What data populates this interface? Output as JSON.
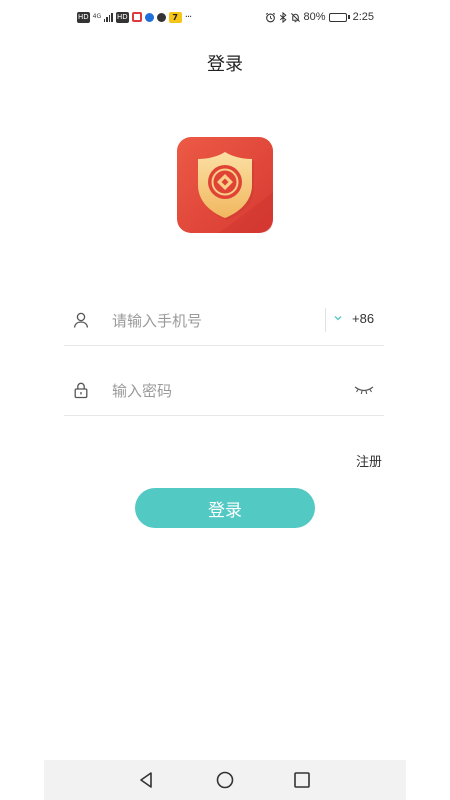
{
  "status_bar": {
    "left_chips": [
      "HD",
      "HD"
    ],
    "network": "4G",
    "more": "···",
    "yellow_badge": "7",
    "battery": "80%",
    "battery_level": 0.8,
    "time": "2:25"
  },
  "header": {
    "title": "登录"
  },
  "form": {
    "phone_placeholder": "请输入手机号",
    "country_code": "+86",
    "password_placeholder": "输入密码"
  },
  "register_label": "注册",
  "login_label": "登录",
  "colors": {
    "accent": "#53c9c3",
    "logo_red": "#e2443a",
    "logo_gold": "#f6c776"
  },
  "icons": [
    "user-icon",
    "lock-icon",
    "chevron-down-icon",
    "eye-closed-icon",
    "back-icon",
    "home-icon",
    "recent-apps-icon"
  ]
}
